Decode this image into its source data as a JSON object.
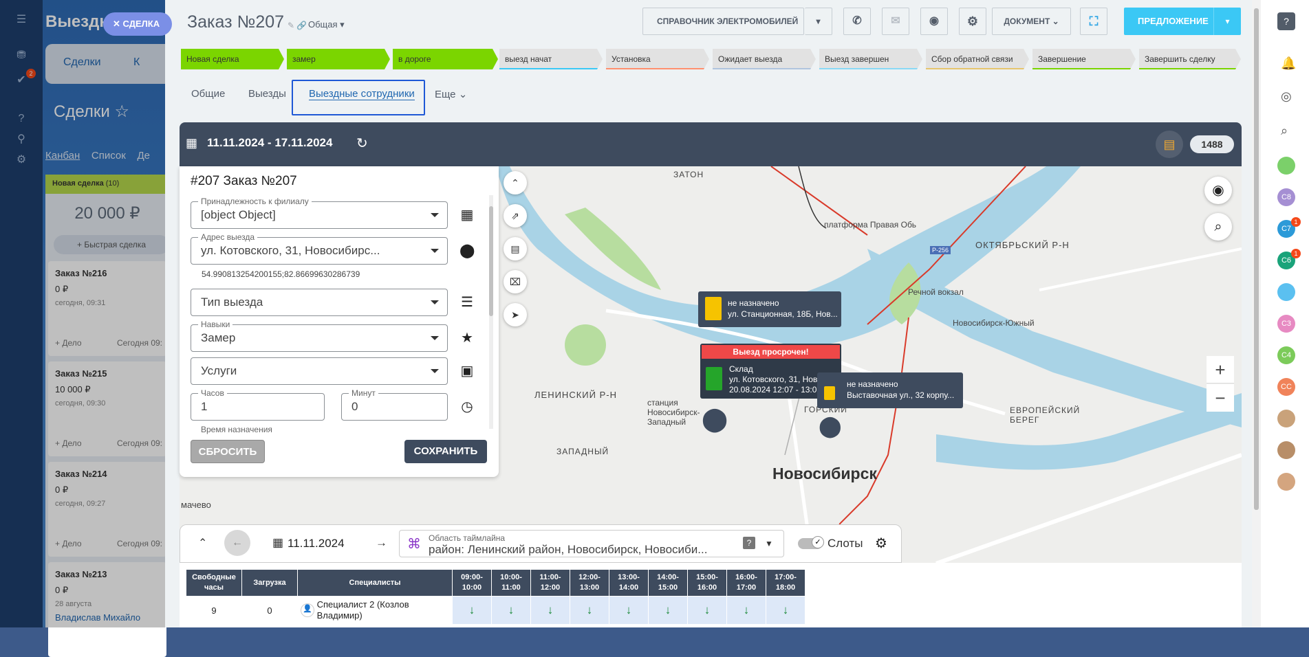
{
  "background": {
    "title": "Выездн",
    "chip": "СДЕЛКА",
    "tabs": [
      "Сделки",
      "К"
    ],
    "deals_title": "Сделки",
    "views": [
      "Канбан",
      "Список",
      "Де"
    ],
    "column": {
      "name": "Новая сделка",
      "count": "(10)",
      "sum": "20 000 ₽",
      "quick_add": "Быстрая сделка"
    },
    "cards": [
      {
        "title": "Заказ №216",
        "sum": "0 ₽",
        "date": "сегодня, 09:31",
        "action": "+ Дело",
        "due": "Сегодня 09:"
      },
      {
        "title": "Заказ №215",
        "sum": "10 000 ₽",
        "date": "сегодня, 09:30",
        "action": "+ Дело",
        "due": "Сегодня 09:"
      },
      {
        "title": "Заказ №214",
        "sum": "0 ₽",
        "date": "сегодня, 09:27",
        "action": "+ Дело",
        "due": "Сегодня 09:"
      },
      {
        "title": "Заказ №213",
        "sum": "0 ₽",
        "date": "28 августа",
        "action": "Владислав Михайло",
        "due": ""
      }
    ],
    "left_badge": "2"
  },
  "header": {
    "title": "Заказ №207",
    "category": "Общая",
    "catalog_btn": "СПРАВОЧНИК ЭЛЕКТРОМОБИЛЕЙ",
    "document_btn": "ДОКУМЕНТ",
    "offer_btn": "ПРЕДЛОЖЕНИЕ"
  },
  "stages": [
    {
      "label": "Новая сделка",
      "color": "#7bd500"
    },
    {
      "label": "замер",
      "color": "#7bd500"
    },
    {
      "label": "в дороге",
      "color": "#7bd500"
    },
    {
      "label": "выезд начат",
      "color": "#e2e2e2"
    },
    {
      "label": "Установка",
      "color": "#e2e2e2"
    },
    {
      "label": "Ожидает выезда",
      "color": "#e2e2e2"
    },
    {
      "label": "Выезд завершен",
      "color": "#e2e2e2"
    },
    {
      "label": "Сбор обратной связи",
      "color": "#e2e2e2"
    },
    {
      "label": "Завершение",
      "color": "#e2e2e2"
    },
    {
      "label": "Завершить сделку",
      "color": "#e2e2e2"
    }
  ],
  "tabs": [
    {
      "label": "Общие"
    },
    {
      "label": "Выезды"
    },
    {
      "label": "Выездные сотрудники"
    },
    {
      "label": "Еще"
    }
  ],
  "mapbar": {
    "date_range": "11.11.2024 - 17.11.2024",
    "count": "1488"
  },
  "form": {
    "title": "#207 Заказ №207",
    "branch_label": "Принадлежность к филиалу",
    "branch_value": "[object Object]",
    "address_label": "Адрес выезда",
    "address_value": "ул. Котовского, 31, Новосибирс...",
    "coords": "54.990813254200155;82.86699630286739",
    "visit_type_placeholder": "Тип выезда",
    "skills_label": "Навыки",
    "skills_value": "Замер",
    "services_placeholder": "Услуги",
    "hours_label": "Часов",
    "hours_value": "1",
    "minutes_label": "Минут",
    "minutes_value": "0",
    "time_label": "Время назначения",
    "reset_btn": "СБРОСИТЬ",
    "save_btn": "СОХРАНИТЬ"
  },
  "map": {
    "labels": [
      "ЗАТОН",
      "платформа Правая Обь",
      "ОКТЯБРЬСКИЙ Р-Н",
      "Речной вокзал",
      "Новосибирск-Южный",
      "ЛЕНИНСКИЙ Р-Н",
      "станция Новосибирск-Западный",
      "ЗАПАДНЫЙ",
      "Новосибирск",
      "ЕВРОПЕЙСКИЙ БЕРЕГ",
      "мачево",
      "ГОРСКИЙ",
      "Р-256"
    ],
    "popups": [
      {
        "status": "не назначено",
        "address": "ул. Станционная, 18Б, Нов..."
      },
      {
        "alert": "Выезд просрочен!",
        "place": "Склад",
        "address": "ул. Котовского, 31, Новос...",
        "time": "20.08.2024 12:07 - 13:07"
      },
      {
        "status": "не назначено",
        "address": "Выставочная ул., 32 корпу..."
      }
    ]
  },
  "timeline": {
    "date": "11.11.2024",
    "area_label": "Область таймлайна",
    "area_value": "район: Ленинский район, Новосибирск, Новосиби...",
    "help": "?",
    "slots_label": "Слоты"
  },
  "table": {
    "headers": [
      "Свободные часы",
      "Загрузка",
      "Специалисты",
      "09:00-10:00",
      "10:00-11:00",
      "11:00-12:00",
      "12:00-13:00",
      "13:00-14:00",
      "14:00-15:00",
      "15:00-16:00",
      "16:00-17:00",
      "17:00-18:00"
    ],
    "rows": [
      {
        "free": "9",
        "load": "0",
        "specialist": "Специалист 2 (Козлов Владимир)",
        "slots": [
          "↓",
          "↓",
          "↓",
          "↓",
          "↓",
          "↓",
          "↓",
          "↓",
          "↓"
        ]
      }
    ]
  },
  "rightbar": [
    {
      "label": "",
      "color": "#7bd06a"
    },
    {
      "label": "С8",
      "color": "#a58fd3"
    },
    {
      "label": "С7",
      "color": "#2c9ad8",
      "badge": "1"
    },
    {
      "label": "С6",
      "color": "#1aa37a",
      "badge": "1"
    },
    {
      "label": "",
      "color": "#5bc0f0"
    },
    {
      "label": "С3",
      "color": "#e78ac2"
    },
    {
      "label": "С4",
      "color": "#7ccb5a"
    },
    {
      "label": "СС",
      "color": "#f0835a"
    }
  ]
}
